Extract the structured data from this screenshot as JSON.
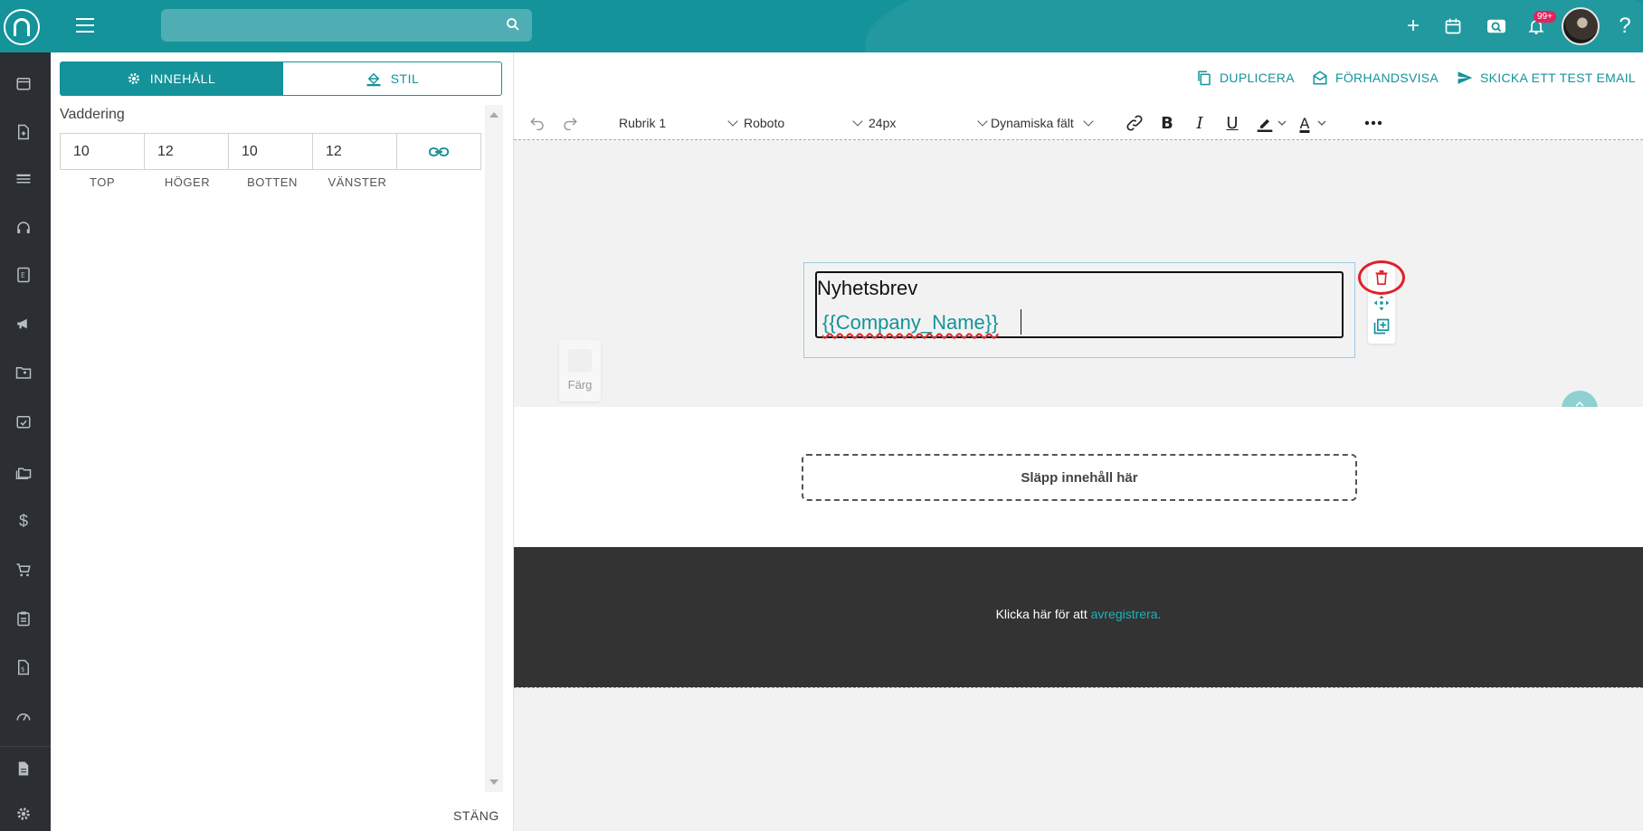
{
  "header": {
    "search_placeholder": "",
    "notification_badge": "99+"
  },
  "panel": {
    "tabs": {
      "content_label": "INNEHÅLL",
      "style_label": "STIL"
    },
    "padding": {
      "title": "Vaddering",
      "values": {
        "top": "10",
        "right": "12",
        "bottom": "10",
        "left": "12"
      },
      "labels": {
        "top": "TOP",
        "right": "HÖGER",
        "bottom": "BOTTEN",
        "left": "VÄNSTER"
      }
    },
    "close_label": "STÄNG"
  },
  "actions": {
    "duplicate": "DUPLICERA",
    "preview": "FÖRHANDSVISA",
    "send_test": "SKICKA ETT TEST EMAIL"
  },
  "toolbar": {
    "block_format": "Rubrik 1",
    "font_family": "Roboto",
    "font_size": "24px",
    "dynamic_fields": "Dynamiska fält"
  },
  "canvas": {
    "color_label": "Färg",
    "heading_text": "Nyhetsbrev",
    "heading_dynamic": "{{Company_Name}}",
    "drop_zone_text": "Släpp innehåll här",
    "footer_text": "Klicka här för att",
    "footer_link": "avregistrera."
  },
  "colors": {
    "brand": "#14939a",
    "rail": "#2b2f33",
    "footer": "#333333",
    "highlight_ring": "#e0202a"
  }
}
